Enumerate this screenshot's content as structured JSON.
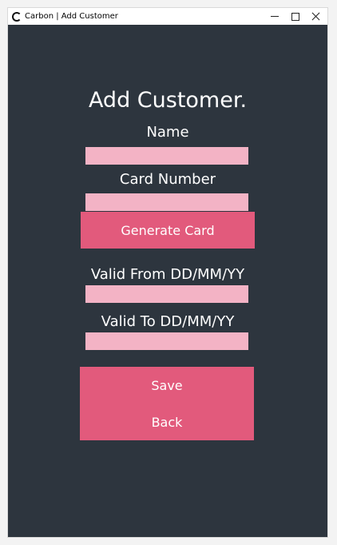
{
  "window": {
    "title": "Carbon | Add Customer",
    "controls": {
      "minimize": "minimize-icon",
      "maximize": "maximize-icon",
      "close": "close-icon"
    }
  },
  "form": {
    "title": "Add Customer.",
    "name_label": "Name",
    "name_value": "",
    "card_label": "Card Number",
    "card_value": "",
    "generate_button": "Generate Card",
    "valid_from_label": "Valid From DD/MM/YY",
    "valid_from_value": "",
    "valid_to_label": "Valid To DD/MM/YY",
    "valid_to_value": "",
    "save_button": "Save",
    "back_button": "Back"
  },
  "colors": {
    "background": "#2d353e",
    "field": "#f3b3c5",
    "button": "#e25a7c",
    "text": "#ffffff"
  }
}
